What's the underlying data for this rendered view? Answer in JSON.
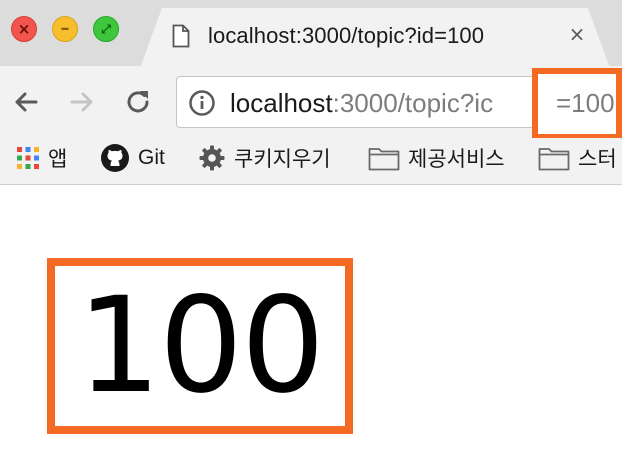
{
  "window": {
    "controls": [
      "close",
      "minimize",
      "fullscreen"
    ]
  },
  "tab": {
    "title": "localhost:3000/topic?id=100",
    "close_label": "×",
    "icon": "document-icon"
  },
  "toolbar": {
    "back_icon": "back-arrow-icon",
    "forward_icon": "forward-arrow-icon",
    "reload_icon": "reload-icon"
  },
  "address_bar": {
    "host": "localhost",
    "rest": ":3000/topic?ic",
    "highlighted_value": "=100",
    "icon": "info-icon"
  },
  "bookmarks": [
    {
      "label": "앱",
      "icon": "apps-grid-icon"
    },
    {
      "label": "Git",
      "icon": "github-icon"
    },
    {
      "label": "쿠키지우기",
      "icon": "gear-icon"
    },
    {
      "label": "제공서비스",
      "icon": "folder-icon"
    },
    {
      "label": "스터",
      "icon": "folder-icon"
    }
  ],
  "page": {
    "value": "100"
  },
  "colors": {
    "highlight": "#f56a23",
    "tab_active": "#f2f2f2",
    "tab_strip": "#dcdcdc"
  }
}
